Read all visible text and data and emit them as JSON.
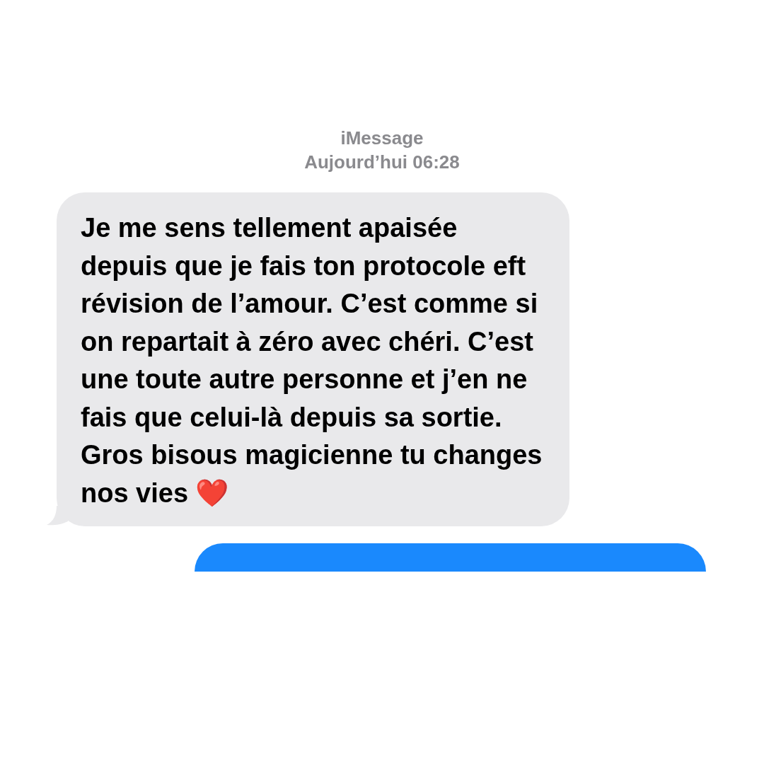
{
  "header": {
    "service": "iMessage",
    "timestamp": "Aujourd’hui 06:28"
  },
  "messages": [
    {
      "kind": "incoming",
      "text": "Je me sens tellement apaisée depuis que je fais ton protocole eft révision de l’amour. C’est comme si on repartait à zéro avec chéri. C’est une toute autre personne et j’en ne fais que celui-là depuis sa sortie. Gros bisous magicienne tu changes nos vies ❤️"
    },
    {
      "kind": "outgoing"
    }
  ]
}
